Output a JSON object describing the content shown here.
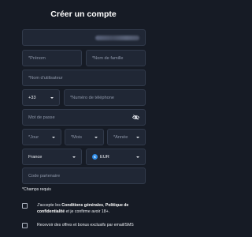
{
  "form": {
    "title": "Créer un compte",
    "email_value": "",
    "firstname_placeholder": "*Prénom",
    "lastname_placeholder": "*Nom de famille",
    "username_placeholder": "*Nom d'utilisateur",
    "phone_code": "+33",
    "phone_placeholder": "*Numéro de téléphone",
    "password_placeholder": "Mot de passe",
    "day_placeholder": "*Jour",
    "month_placeholder": "*Mois",
    "year_placeholder": "*Année",
    "country_value": "France",
    "currency_symbol": "€",
    "currency_value": "EUR",
    "promo_placeholder": "Code partenaire",
    "required_note": "*Champs requis"
  },
  "consent": {
    "terms_prefix": "J'accepte les ",
    "terms_link": "Conditions générales",
    "terms_sep": ", ",
    "privacy_link": "Politique de confidentialité",
    "terms_suffix": " et je confirme avoir 18+.",
    "offers_text": "Recevoir des offres et bonus exclusifs par email/SMS"
  },
  "icons": {
    "password_toggle": "eye-slash-icon",
    "dropdown": "chevron-down-icon",
    "currency": "euro-icon"
  }
}
